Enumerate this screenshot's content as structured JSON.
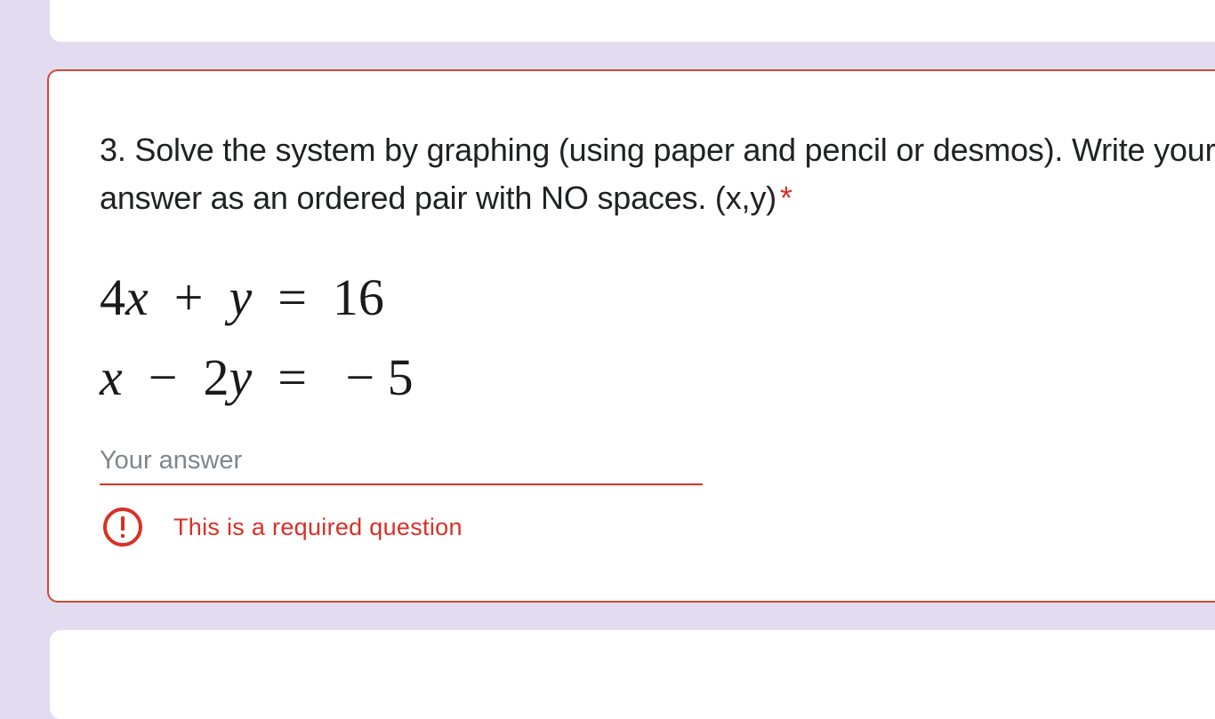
{
  "question": {
    "title": "3. Solve the system by graphing (using paper and pencil or desmos). Write your answer as an ordered pair with NO spaces. (x,y)",
    "required_marker": "*",
    "equations": [
      "4x + y = 16",
      "x − 2y = − 5"
    ],
    "answer_placeholder": "Your answer",
    "answer_value": "",
    "error_message": "This is a required question"
  },
  "colors": {
    "background": "#e2dcf1",
    "error": "#d93025",
    "border_error": "#d14836",
    "text": "#202124"
  },
  "icons": {
    "error": "error-circle-icon"
  }
}
